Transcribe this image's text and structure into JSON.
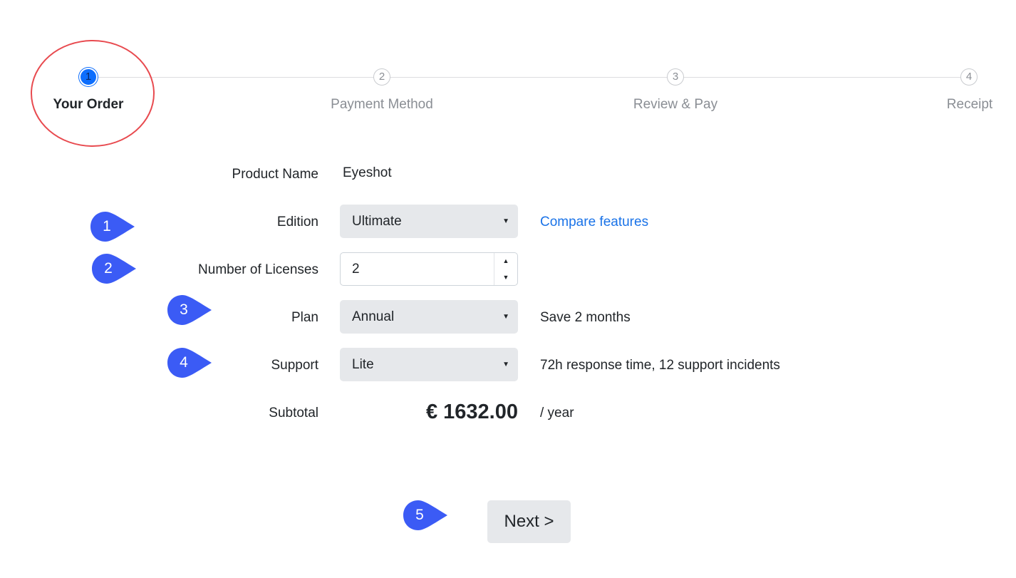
{
  "stepper": {
    "steps": [
      {
        "number": "1",
        "label": "Your Order",
        "active": true
      },
      {
        "number": "2",
        "label": "Payment Method",
        "active": false
      },
      {
        "number": "3",
        "label": "Review & Pay",
        "active": false
      },
      {
        "number": "4",
        "label": "Receipt",
        "active": false
      }
    ]
  },
  "form": {
    "product_name": {
      "label": "Product Name",
      "value": "Eyeshot"
    },
    "edition": {
      "label": "Edition",
      "value": "Ultimate",
      "link": "Compare features"
    },
    "licenses": {
      "label": "Number of Licenses",
      "value": "2"
    },
    "plan": {
      "label": "Plan",
      "value": "Annual",
      "note": "Save 2 months"
    },
    "support": {
      "label": "Support",
      "value": "Lite",
      "note": "72h response time, 12 support incidents"
    },
    "subtotal": {
      "label": "Subtotal",
      "amount": "€ 1632.00",
      "period": "/ year"
    }
  },
  "next_button": {
    "label": "Next >"
  },
  "callouts": [
    "1",
    "2",
    "3",
    "4",
    "5"
  ],
  "colors": {
    "accent": "#0d6efd",
    "callout": "#3b5bf5",
    "highlight_ring": "#e84a4f",
    "link": "#1a73e8"
  }
}
